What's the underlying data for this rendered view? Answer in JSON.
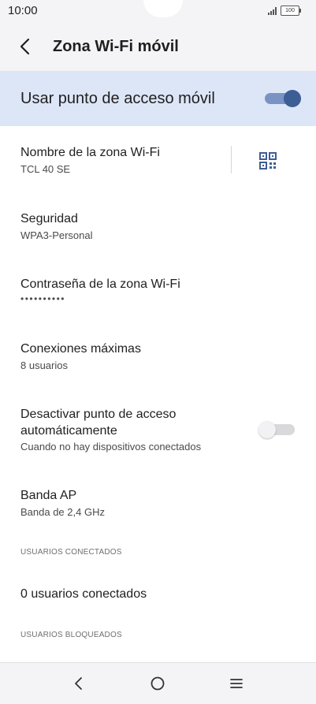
{
  "status_bar": {
    "time": "10:00",
    "battery_level": "100"
  },
  "header": {
    "title": "Zona Wi-Fi móvil",
    "back_icon": "chevron-left-icon"
  },
  "hotspot_toggle": {
    "label": "Usar punto de acceso móvil",
    "enabled": true,
    "accent": "#3d5d95"
  },
  "settings": {
    "network_name": {
      "title": "Nombre de la zona Wi-Fi",
      "value": "TCL 40 SE",
      "action_icon": "qr-code-icon"
    },
    "security": {
      "title": "Seguridad",
      "value": "WPA3-Personal"
    },
    "password": {
      "title": "Contraseña de la zona Wi-Fi",
      "value": "••••••••••"
    },
    "max_connections": {
      "title": "Conexiones máximas",
      "value": "8 usuarios"
    },
    "auto_off": {
      "title_line1": "Desactivar punto de acceso",
      "title_line2": "automáticamente",
      "value": "Cuando no hay dispositivos conectados",
      "enabled": false
    },
    "ap_band": {
      "title": "Banda AP",
      "value": "Banda de 2,4 GHz"
    }
  },
  "connected_users": {
    "section_title": "USUARIOS CONECTADOS",
    "value": "0 usuarios conectados"
  },
  "blocked_users": {
    "section_title": "USUARIOS BLOQUEADOS"
  },
  "nav_bar": {
    "back_icon": "back-chevron-icon",
    "home_icon": "home-circle-icon",
    "menu_icon": "menu-lines-icon"
  }
}
